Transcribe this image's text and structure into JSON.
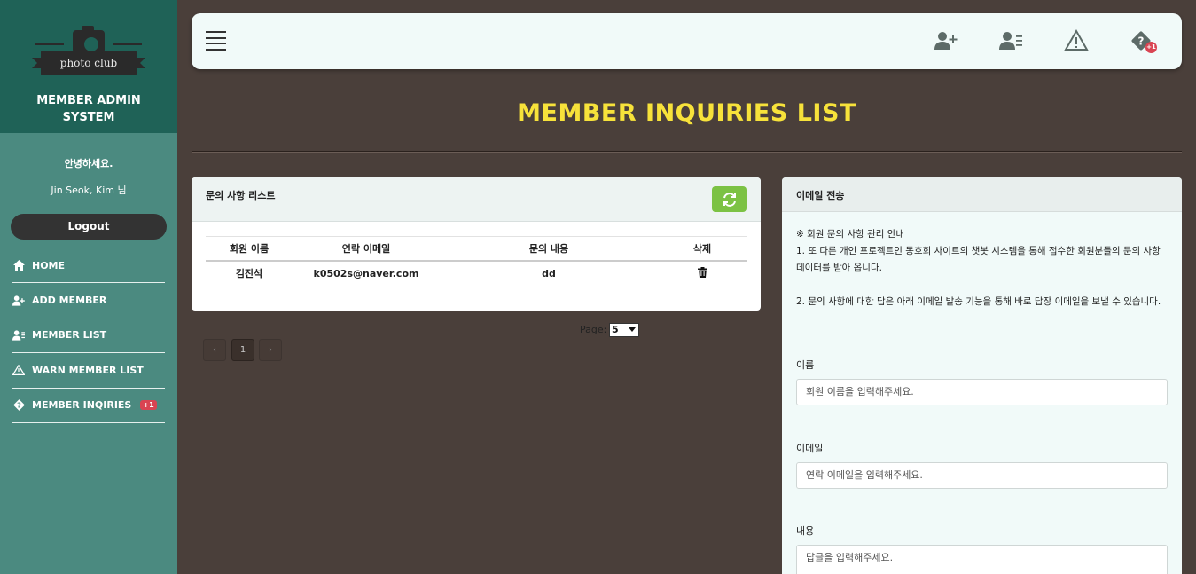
{
  "sidebar": {
    "logo_text": "photo club",
    "system_title_line1": "MEMBER ADMIN",
    "system_title_line2": "SYSTEM",
    "greeting": "안녕하세요.",
    "user_name": "Jin Seok, Kim 님",
    "logout_label": "Logout",
    "items": [
      {
        "label": "HOME",
        "icon": "home-icon"
      },
      {
        "label": "ADD MEMBER",
        "icon": "add-user-icon"
      },
      {
        "label": "MEMBER LIST",
        "icon": "user-list-icon"
      },
      {
        "label": "WARN MEMBER LIST",
        "icon": "warning-icon"
      },
      {
        "label": "MEMBER INQIRIES",
        "icon": "question-icon",
        "badge": "+1"
      }
    ]
  },
  "topbar": {
    "icons": [
      "menu-icon",
      "add-user-icon",
      "user-list-icon",
      "warning-icon",
      "question-icon"
    ],
    "badge": "+1"
  },
  "page_title": "MEMBER INQUIRIES LIST",
  "inquiry_card": {
    "title": "문의 사항 리스트",
    "columns": [
      "회원 이름",
      "연락 이메일",
      "문의 내용",
      "삭제"
    ],
    "rows": [
      {
        "name": "김진석",
        "email": "k0502s@naver.com",
        "content": "dd"
      }
    ]
  },
  "pager": {
    "label": "Page:",
    "page_size": "5",
    "prev": "‹",
    "current": "1",
    "next": "›"
  },
  "email_card": {
    "title": "이메일 전송",
    "notice_title": "※ 회원 문의 사항 관리 안내",
    "notice_1": "1. 또 다른 개인 프로젝트인 동호회 사이트의 챗봇 시스템을 통해 접수한 회원분들의 문의 사항 데이터를 받아 옵니다.",
    "notice_2": "2. 문의 사항에 대한 답은 아래 이메일 발송 기능을 통해 바로 답장 이메일을 보낼 수 있습니다.",
    "name_label": "이름",
    "name_placeholder": "회원 이름을 입력해주세요.",
    "email_label": "이메일",
    "email_placeholder": "연락 이메일을 입력해주세요.",
    "content_label": "내용",
    "content_placeholder": "답글을 입력해주세요."
  },
  "colors": {
    "sidebar": "#4b8a80",
    "sidebar_top": "#1f6257",
    "background": "#4a3f3a",
    "title": "#f7e23a",
    "refresh": "#7cc244",
    "badge": "#d94452"
  }
}
